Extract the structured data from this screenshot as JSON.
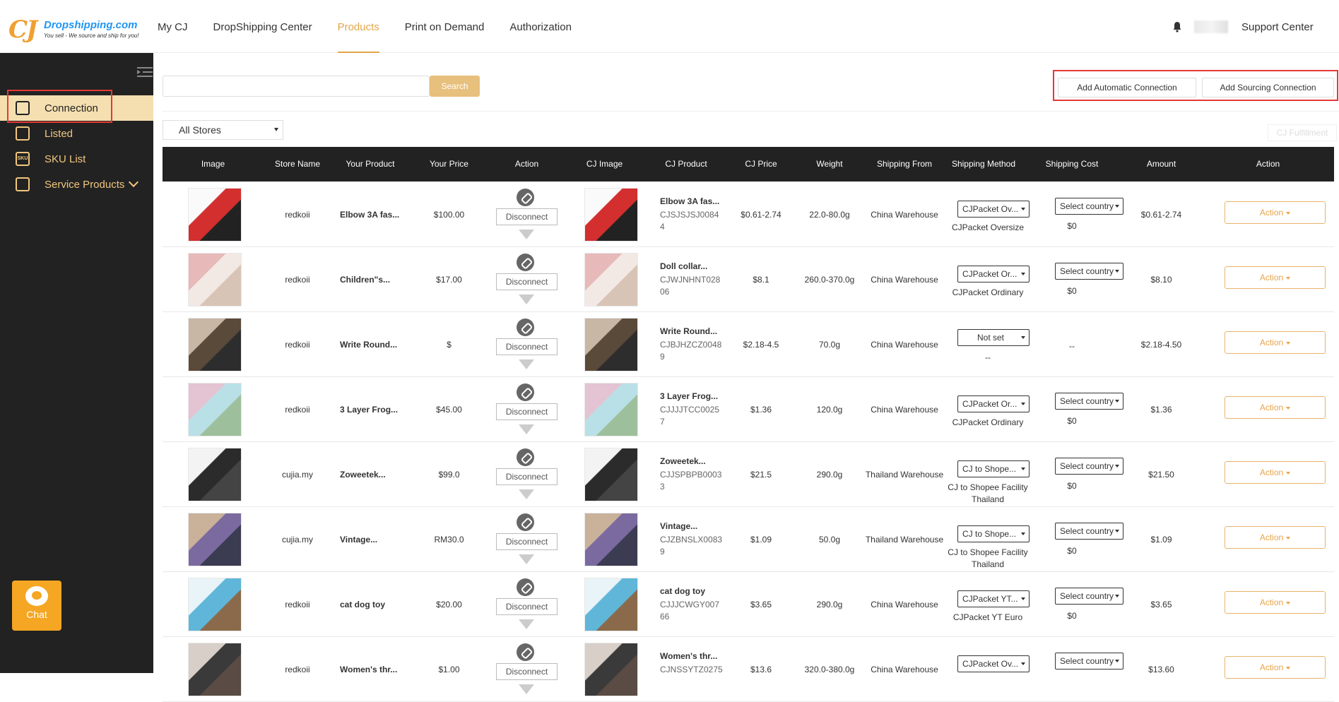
{
  "brand": {
    "name": "Dropshipping.com",
    "tagline": "You sell - We source and ship for you!"
  },
  "nav": [
    {
      "label": "My CJ"
    },
    {
      "label": "DropShipping Center"
    },
    {
      "label": "Products",
      "active": true
    },
    {
      "label": "Print on Demand"
    },
    {
      "label": "Authorization"
    }
  ],
  "header": {
    "support_label": "Support Center"
  },
  "sidebar": {
    "items": [
      {
        "label": "Connection",
        "icon": "connection-icon",
        "active": true
      },
      {
        "label": "Listed",
        "icon": "listed-icon"
      },
      {
        "label": "SKU List",
        "icon": "sku-icon",
        "icon_text": "SKU"
      },
      {
        "label": "Service Products",
        "icon": "service-icon"
      }
    ],
    "chat_label": "Chat"
  },
  "search": {
    "placeholder": "",
    "button_label": "Search"
  },
  "actions": {
    "auto_label": "Add Automatic Connection",
    "sourcing_label": "Add Sourcing Connection"
  },
  "filter": {
    "store_selected": "All Stores",
    "fulfillment_label": "CJ Fulfillment"
  },
  "table": {
    "headers": [
      "Image",
      "Store Name",
      "Your Product",
      "Your Price",
      "Action",
      "CJ Image",
      "CJ Product",
      "CJ Price",
      "Weight",
      "Shipping From",
      "Shipping Method",
      "Shipping Cost",
      "Amount",
      "Action"
    ],
    "disconnect_label": "Disconnect",
    "action_label": "Action",
    "rows": [
      {
        "store": "redkoii",
        "product": "Elbow 3A fas...",
        "price": "$100.00",
        "cj_product": "Elbow 3A fas...",
        "cj_code": "CJSJSJSJ00844",
        "cj_price": "$0.61-2.74",
        "weight": "22.0-80.0g",
        "from": "China Warehouse",
        "method": "CJPacket Ov...",
        "method_sub": "CJPacket Oversize",
        "cost": "Select country",
        "cost_sub": "$0",
        "amount": "$0.61-2.74"
      },
      {
        "store": "redkoii",
        "product": "Children\"s...",
        "price": "$17.00",
        "cj_product": "Doll collar...",
        "cj_code": "CJWJNHNT02806",
        "cj_price": "$8.1",
        "weight": "260.0-370.0g",
        "from": "China Warehouse",
        "method": "CJPacket Or...",
        "method_sub": "CJPacket Ordinary",
        "cost": "Select country",
        "cost_sub": "$0",
        "amount": "$8.10"
      },
      {
        "store": "redkoii",
        "product": "Write Round...",
        "price": "$",
        "cj_product": "Write Round...",
        "cj_code": "CJBJHZCZ00489",
        "cj_price": "$2.18-4.5",
        "weight": "70.0g",
        "from": "China Warehouse",
        "method": "Not set",
        "method_sub": "--",
        "cost": "",
        "cost_sub": "--",
        "amount": "$2.18-4.50"
      },
      {
        "store": "redkoii",
        "product": "3 Layer Frog...",
        "price": "$45.00",
        "cj_product": "3 Layer Frog...",
        "cj_code": "CJJJJTCC00257",
        "cj_price": "$1.36",
        "weight": "120.0g",
        "from": "China Warehouse",
        "method": "CJPacket Or...",
        "method_sub": "CJPacket Ordinary",
        "cost": "Select country",
        "cost_sub": "$0",
        "amount": "$1.36"
      },
      {
        "store": "cujia.my",
        "product": "Zoweetek...",
        "price": "$99.0",
        "cj_product": "Zoweetek...",
        "cj_code": "CJJSPBPB00033",
        "cj_price": "$21.5",
        "weight": "290.0g",
        "from": "Thailand Warehouse",
        "method": "CJ to Shope...",
        "method_sub": "CJ to Shopee Facility Thailand",
        "cost": "Select country",
        "cost_sub": "$0",
        "amount": "$21.50"
      },
      {
        "store": "cujia.my",
        "product": "Vintage...",
        "price": "RM30.0",
        "cj_product": "Vintage...",
        "cj_code": "CJZBNSLX00839",
        "cj_price": "$1.09",
        "weight": "50.0g",
        "from": "Thailand Warehouse",
        "method": "CJ to Shope...",
        "method_sub": "CJ to Shopee Facility Thailand",
        "cost": "Select country",
        "cost_sub": "$0",
        "amount": "$1.09"
      },
      {
        "store": "redkoii",
        "product": "cat dog toy",
        "price": "$20.00",
        "cj_product": "cat dog toy",
        "cj_code": "CJJJCWGY00766",
        "cj_price": "$3.65",
        "weight": "290.0g",
        "from": "China Warehouse",
        "method": "CJPacket YT...",
        "method_sub": "CJPacket YT Euro",
        "cost": "Select country",
        "cost_sub": "$0",
        "amount": "$3.65"
      },
      {
        "store": "redkoii",
        "product": "Women's thr...",
        "price": "$1.00",
        "cj_product": "Women's thr...",
        "cj_code": "CJNSSYTZ0275",
        "cj_price": "$13.6",
        "weight": "320.0-380.0g",
        "from": "China Warehouse",
        "method": "CJPacket Ov...",
        "method_sub": "",
        "cost": "Select country",
        "cost_sub": "",
        "amount": "$13.60"
      }
    ]
  },
  "colors": {
    "accent": "#e2a64a",
    "sidebar_bg": "#222222",
    "active_bg": "#f5dfb0",
    "highlight_red": "#e53935"
  }
}
